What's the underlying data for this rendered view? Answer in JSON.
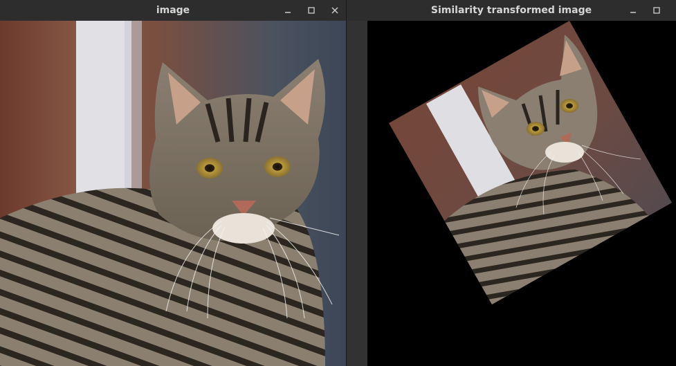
{
  "windows": [
    {
      "title": "image",
      "controls": [
        "minimize-icon",
        "maximize-icon",
        "close-icon"
      ]
    },
    {
      "title": "Similarity transformed image",
      "controls": [
        "minimize-icon",
        "maximize-icon"
      ]
    }
  ],
  "colors": {
    "titlebar_bg": "#2d2d2d",
    "title_text": "#d6d6d6",
    "canvas_bg": "#000000"
  }
}
